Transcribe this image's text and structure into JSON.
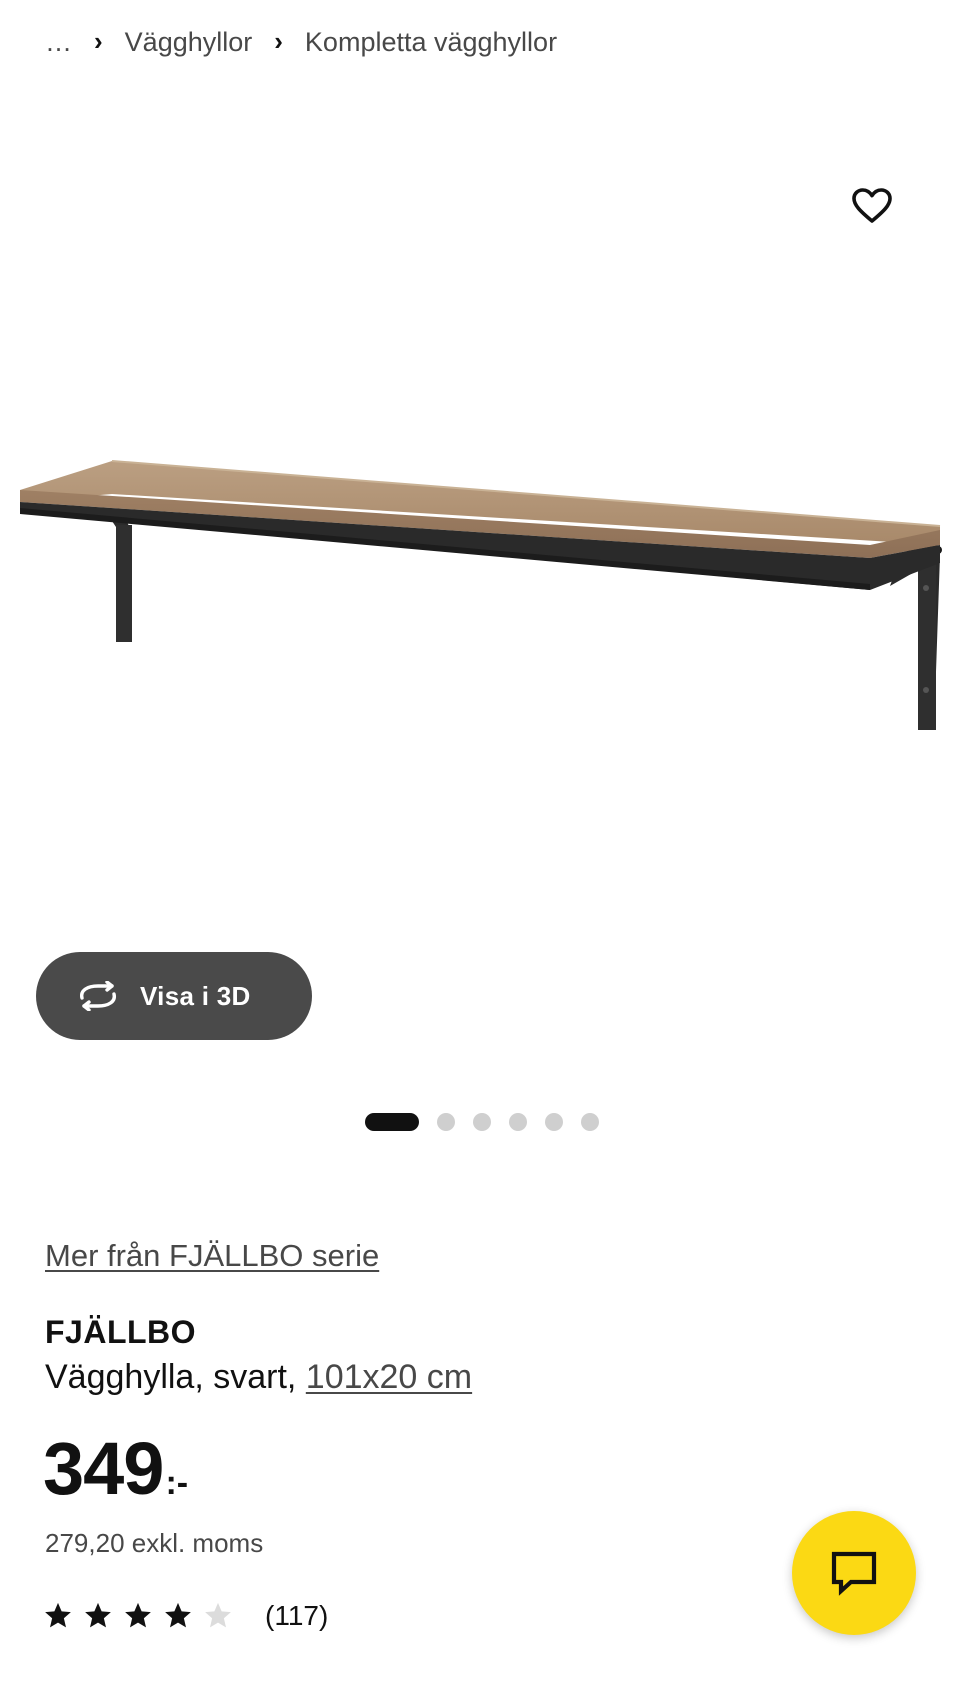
{
  "breadcrumb": {
    "ellipsis": "…",
    "items": [
      "Vägghyllor",
      "Kompletta vägghyllor"
    ],
    "separator": "›"
  },
  "product_image": {
    "alt": "FJÄLLBO vägghylla"
  },
  "favorite_icon": "heart-outline-icon",
  "view3d": {
    "label": "Visa i 3D",
    "icon": "rotate-3d-icon"
  },
  "carousel": {
    "total": 6,
    "active_index": 0
  },
  "series_link": "Mer från FJÄLLBO serie",
  "product": {
    "name": "FJÄLLBO",
    "description": "Vägghylla, svart, ",
    "size": "101x20 cm"
  },
  "price": {
    "amount": "349",
    "suffix": ":-",
    "excl_vat": "279,20 exkl. moms"
  },
  "rating": {
    "stars": 4,
    "max": 5,
    "count": "(117)"
  },
  "chat": {
    "icon": "chat-bubble-icon",
    "color": "#fbd914"
  },
  "colors": {
    "view3d_bg": "#4a4a4a",
    "dot_active": "#111111",
    "dot_inactive": "#cfcfcf"
  }
}
